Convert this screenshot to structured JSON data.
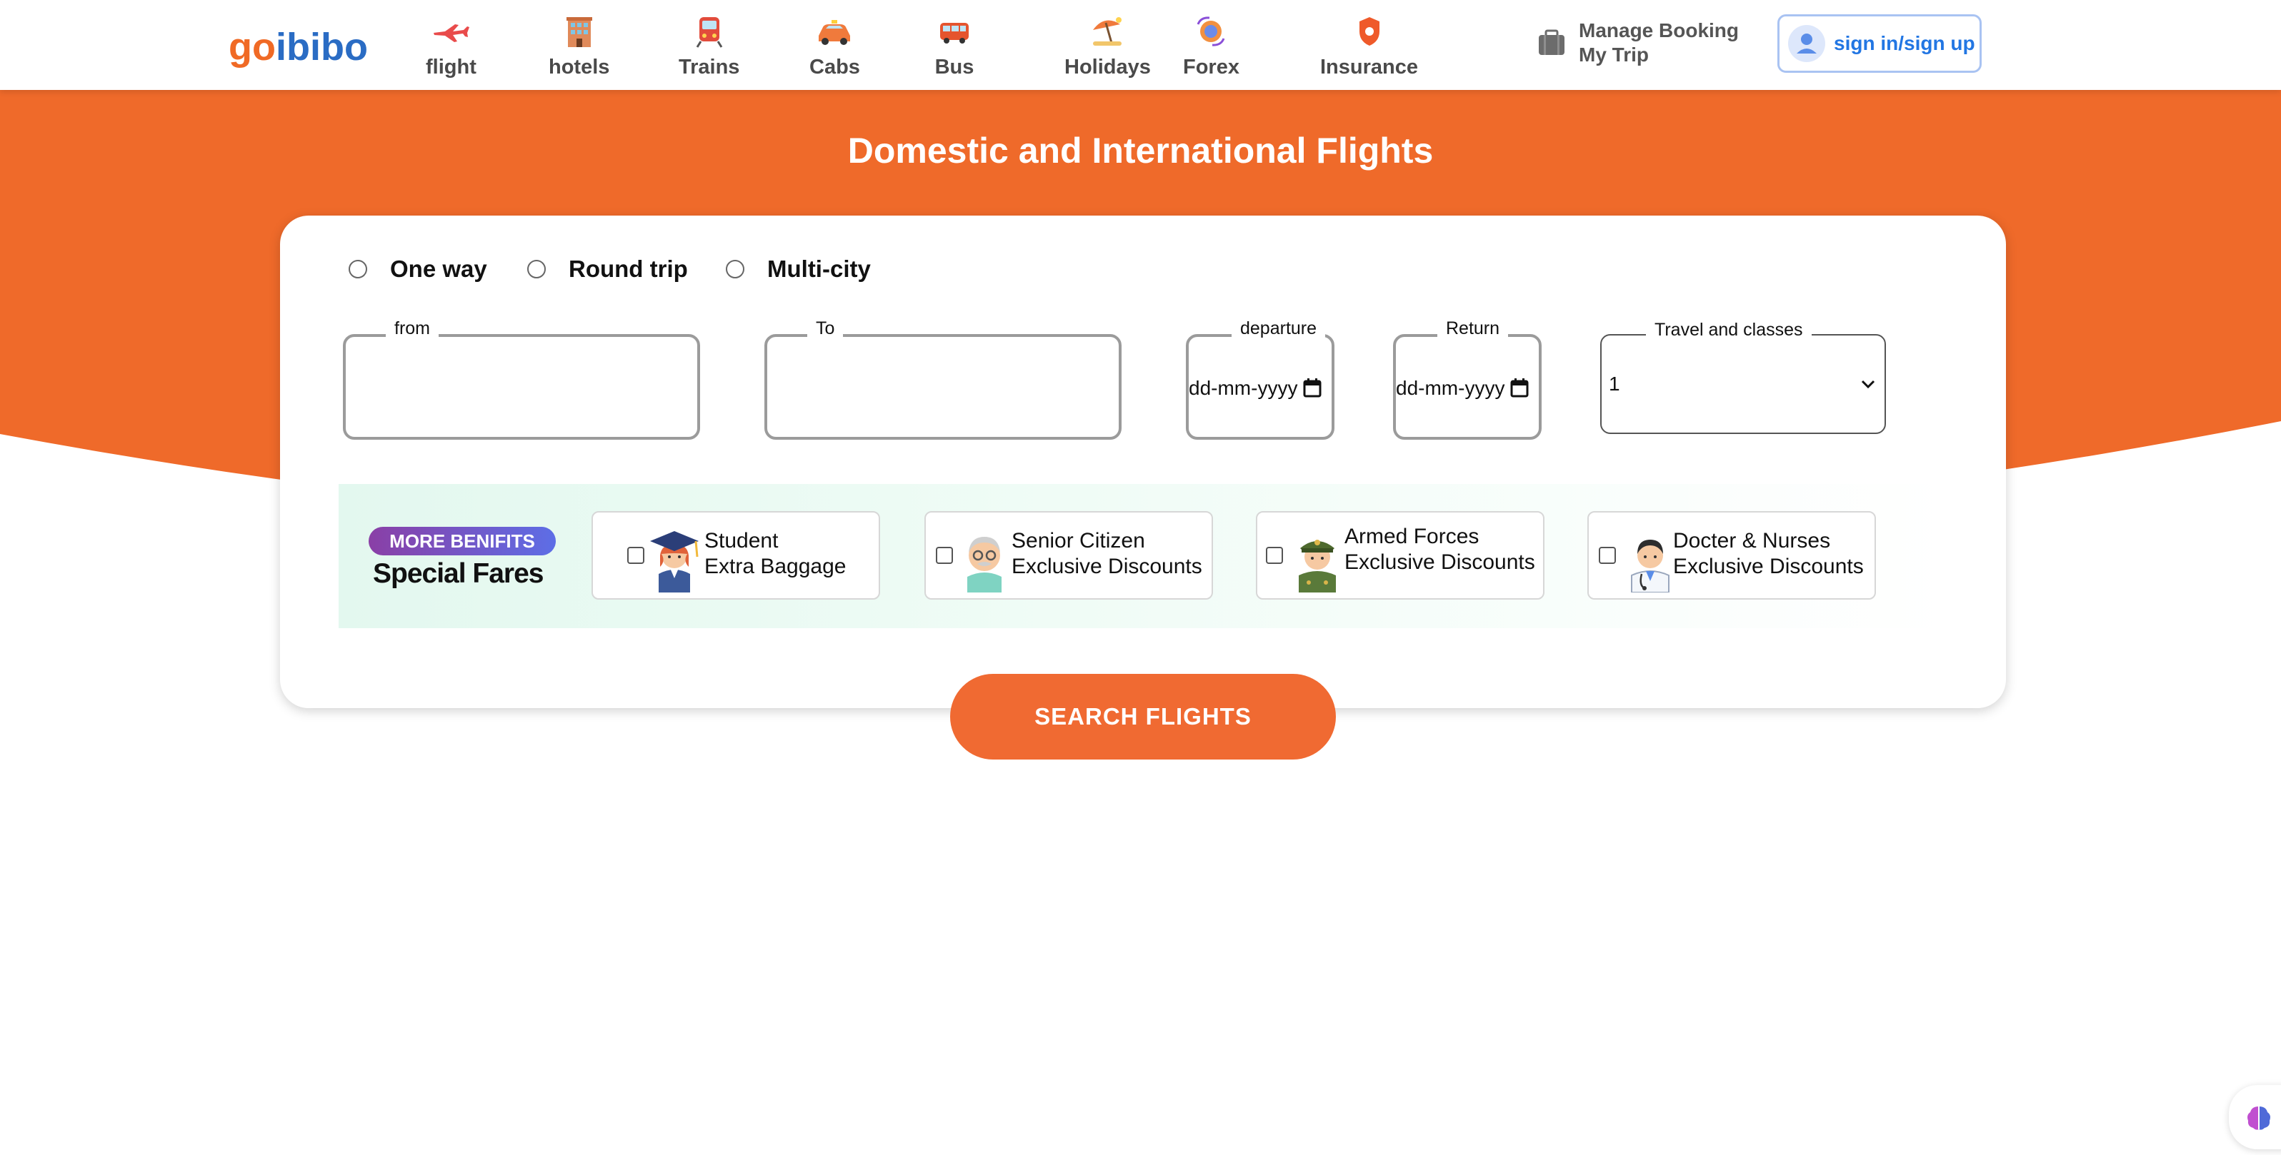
{
  "brand": {
    "logo": [
      "g",
      "o",
      "i",
      "b",
      "i",
      "b",
      "o"
    ],
    "orange": "#f06a25",
    "blue": "#2a6cc4",
    "accent": "#f06a32"
  },
  "nav": {
    "items": [
      {
        "label": "flight",
        "icon": "airplane-icon"
      },
      {
        "label": "hotels",
        "icon": "hotel-building-icon"
      },
      {
        "label": "Trains",
        "icon": "train-icon"
      },
      {
        "label": "Cabs",
        "icon": "car-icon"
      },
      {
        "label": "Bus",
        "icon": "bus-icon"
      },
      {
        "label": "Holidays",
        "icon": "beach-umbrella-icon"
      },
      {
        "label": "Forex",
        "icon": "currency-exchange-icon"
      },
      {
        "label": "Insurance",
        "icon": "shield-icon"
      }
    ],
    "manage_booking": "Manage Booking",
    "my_trip": "My Trip",
    "sign_in": "sign in/sign up"
  },
  "hero": {
    "title": "Domestic and International Flights"
  },
  "search": {
    "trip_types": [
      "One way",
      "Round trip",
      "Multi-city"
    ],
    "from_label": "from",
    "to_label": "To",
    "departure_label": "departure",
    "departure_value": "dd-mm-yyyy",
    "return_label": "Return",
    "return_value": "dd-mm-yyyy",
    "travel_label": "Travel and classes",
    "travel_value": "1"
  },
  "fares": {
    "badge": "MORE BENIFITS",
    "title": "Special Fares",
    "options": [
      {
        "line1": "Student",
        "line2": "Extra Baggage"
      },
      {
        "line1": "Senior Citizen",
        "line2": "Exclusive Discounts"
      },
      {
        "line1": "Armed Forces",
        "line2": "Exclusive Discounts"
      },
      {
        "line1": "Docter & Nurses",
        "line2": "Exclusive Discounts"
      }
    ]
  },
  "search_button": "SEARCH FLIGHTS"
}
